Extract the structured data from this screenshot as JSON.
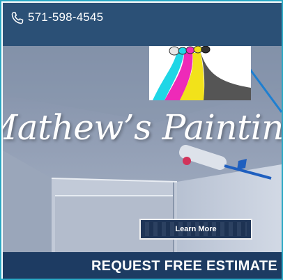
{
  "header": {
    "phone_icon": "phone-icon",
    "phone_number": "571-598-4545"
  },
  "hero": {
    "headline": "Mathew’s Painting",
    "learn_more_label": "Learn More"
  },
  "cta": {
    "label": "REQUEST FREE ESTIMATE"
  },
  "colors": {
    "header_bg": "#2b5076",
    "cta_bg": "#1d3b62",
    "button_bg": "#1f3557",
    "frame_border": "#2aa8c4",
    "paint_cyan": "#1fd6e6",
    "paint_magenta": "#ee2ab8",
    "paint_yellow": "#f2e21a"
  }
}
